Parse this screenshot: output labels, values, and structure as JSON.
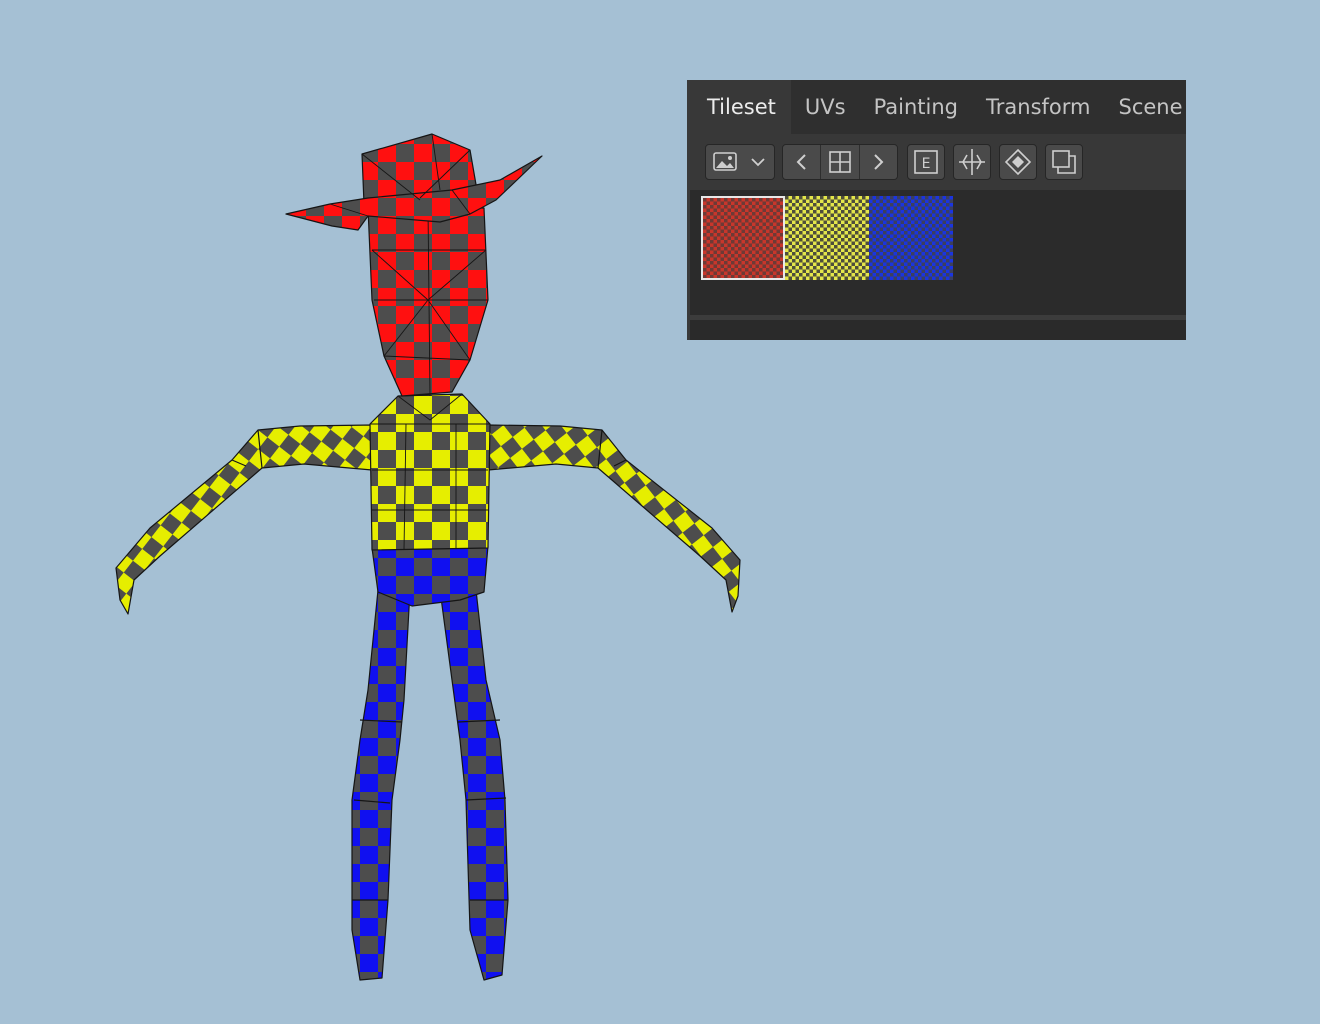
{
  "colors": {
    "viewport_bg": "#a5c0d4",
    "hat_head": "#ff1010",
    "shirt": "#e6ee00",
    "pants": "#1010f0",
    "check_dark": "#4d4d4d"
  },
  "panel": {
    "tabs": [
      {
        "label": "Tileset",
        "active": true
      },
      {
        "label": "UVs"
      },
      {
        "label": "Painting"
      },
      {
        "label": "Transform"
      },
      {
        "label": "Scene"
      }
    ],
    "toolbar": {
      "image_dropdown_icon": "image-icon",
      "prev_icon": "chevron-left-icon",
      "grid_icon": "grid-layout-icon",
      "next_icon": "chevron-right-icon",
      "edit_label": "E",
      "extra_icons": [
        "align-tool-icon",
        "layers-icon",
        "copy-icon"
      ]
    },
    "tiles": [
      {
        "name": "red-checker-tile",
        "color": "red",
        "selected": true
      },
      {
        "name": "yellow-checker-tile",
        "color": "yellow"
      },
      {
        "name": "blue-checker-tile",
        "color": "blue"
      }
    ]
  }
}
